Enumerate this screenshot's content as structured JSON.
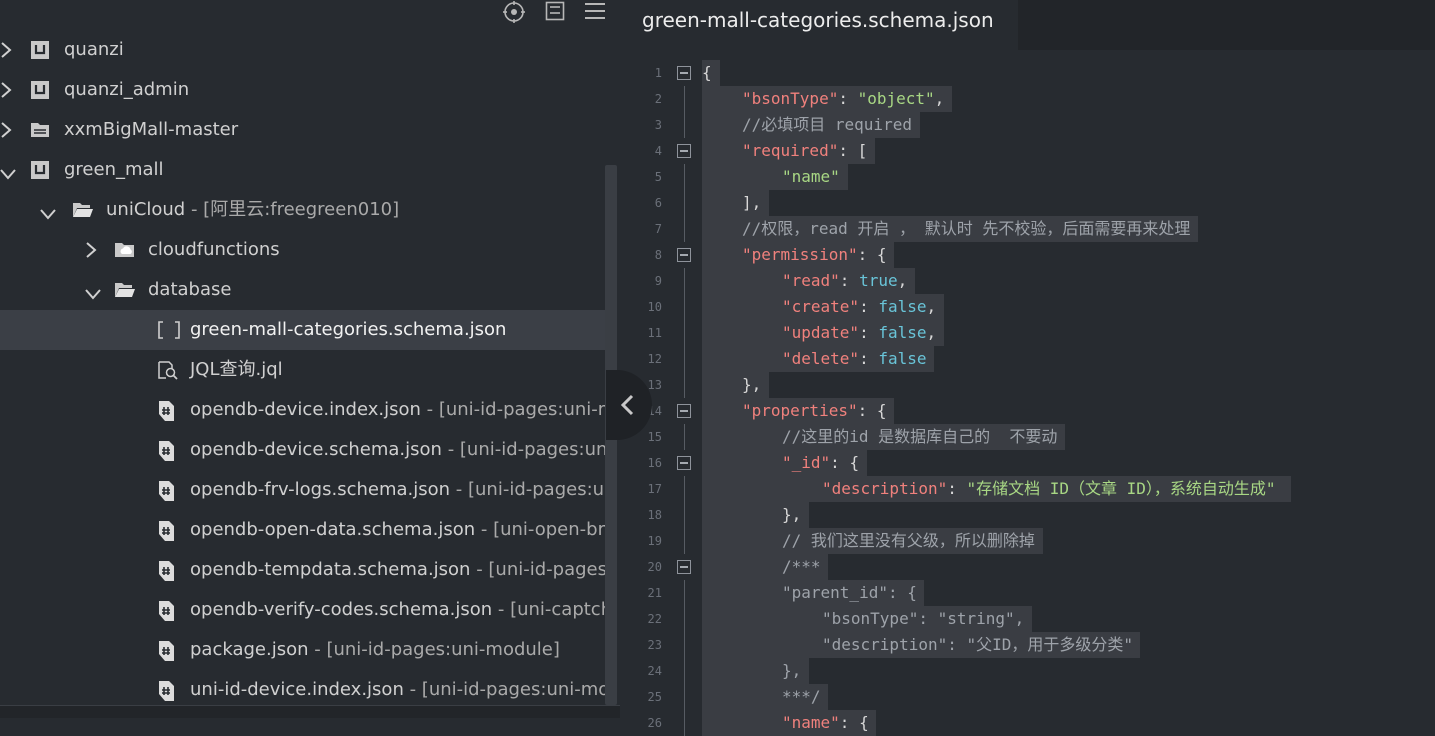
{
  "sidebar": {
    "toolbar": [
      {
        "name": "locate-icon"
      },
      {
        "name": "collapse-all-icon"
      },
      {
        "name": "menu-icon"
      }
    ],
    "tree": [
      {
        "label": "quanzi",
        "desc": "",
        "depth": 0,
        "chevron": "right",
        "icon": "project-icon"
      },
      {
        "label": "quanzi_admin",
        "desc": "",
        "depth": 0,
        "chevron": "right",
        "icon": "project-icon"
      },
      {
        "label": "xxmBigMall-master",
        "desc": "",
        "depth": 0,
        "chevron": "right",
        "icon": "folder-stack-icon"
      },
      {
        "label": "green_mall",
        "desc": "",
        "depth": 0,
        "chevron": "down",
        "icon": "project-icon"
      },
      {
        "label": "uniCloud",
        "desc": " - [阿里云:freegreen010]",
        "depth": 1,
        "chevron": "down",
        "icon": "folder-open-icon"
      },
      {
        "label": "cloudfunctions",
        "desc": "",
        "depth": 2,
        "chevron": "right",
        "icon": "cloud-folder-icon"
      },
      {
        "label": "database",
        "desc": "",
        "depth": 2,
        "chevron": "down",
        "icon": "folder-open-icon"
      },
      {
        "label": "green-mall-categories.schema.json",
        "desc": "",
        "depth": 3,
        "chevron": "",
        "icon": "json-bracket-icon",
        "selected": true
      },
      {
        "label": "JQL查询.jql",
        "desc": "",
        "depth": 3,
        "chevron": "",
        "icon": "jql-search-icon"
      },
      {
        "label": "opendb-device.index.json",
        "desc": " - [uni-id-pages:uni-mo",
        "depth": 3,
        "chevron": "",
        "icon": "json-file-icon"
      },
      {
        "label": "opendb-device.schema.json",
        "desc": " - [uni-id-pages:uni-",
        "depth": 3,
        "chevron": "",
        "icon": "json-file-icon"
      },
      {
        "label": "opendb-frv-logs.schema.json",
        "desc": " - [uni-id-pages:un",
        "depth": 3,
        "chevron": "",
        "icon": "json-file-icon"
      },
      {
        "label": "opendb-open-data.schema.json",
        "desc": " - [uni-open-bric",
        "depth": 3,
        "chevron": "",
        "icon": "json-file-icon"
      },
      {
        "label": "opendb-tempdata.schema.json",
        "desc": " - [uni-id-pages:u",
        "depth": 3,
        "chevron": "",
        "icon": "json-file-icon"
      },
      {
        "label": "opendb-verify-codes.schema.json",
        "desc": " - [uni-captcha",
        "depth": 3,
        "chevron": "",
        "icon": "json-file-icon"
      },
      {
        "label": "package.json",
        "desc": " - [uni-id-pages:uni-module]",
        "depth": 3,
        "chevron": "",
        "icon": "json-file-icon"
      },
      {
        "label": "uni-id-device.index.json",
        "desc": " - [uni-id-pages:uni-moc",
        "depth": 3,
        "chevron": "",
        "icon": "json-file-icon"
      }
    ]
  },
  "editor": {
    "tab_title": "green-mall-categories.schema.json",
    "lines": [
      {
        "n": "1",
        "indent": 0,
        "fold": "open",
        "tokens": [
          [
            "p",
            "{"
          ]
        ]
      },
      {
        "n": "2",
        "indent": 1,
        "tokens": [
          [
            "k",
            "\"bsonType\""
          ],
          [
            "p",
            ": "
          ],
          [
            "s",
            "\"object\""
          ],
          [
            "p",
            ","
          ]
        ]
      },
      {
        "n": "3",
        "indent": 1,
        "tokens": [
          [
            "c",
            "//必填项目 required"
          ]
        ]
      },
      {
        "n": "4",
        "indent": 1,
        "fold": "open",
        "tokens": [
          [
            "k",
            "\"required\""
          ],
          [
            "p",
            ": ["
          ]
        ]
      },
      {
        "n": "5",
        "indent": 2,
        "tokens": [
          [
            "s",
            "\"name\""
          ]
        ]
      },
      {
        "n": "6",
        "indent": 1,
        "tokens": [
          [
            "p",
            "],"
          ]
        ]
      },
      {
        "n": "7",
        "indent": 1,
        "tokens": [
          [
            "c",
            "//权限，read 开启 ， 默认时 先不校验，后面需要再来处理"
          ]
        ]
      },
      {
        "n": "8",
        "indent": 1,
        "fold": "open",
        "tokens": [
          [
            "k",
            "\"permission\""
          ],
          [
            "p",
            ": {"
          ]
        ]
      },
      {
        "n": "9",
        "indent": 2,
        "tokens": [
          [
            "k",
            "\"read\""
          ],
          [
            "p",
            ": "
          ],
          [
            "b",
            "true"
          ],
          [
            "p",
            ","
          ]
        ]
      },
      {
        "n": "10",
        "indent": 2,
        "tokens": [
          [
            "k",
            "\"create\""
          ],
          [
            "p",
            ": "
          ],
          [
            "b",
            "false"
          ],
          [
            "p",
            ","
          ]
        ]
      },
      {
        "n": "11",
        "indent": 2,
        "tokens": [
          [
            "k",
            "\"update\""
          ],
          [
            "p",
            ": "
          ],
          [
            "b",
            "false"
          ],
          [
            "p",
            ","
          ]
        ]
      },
      {
        "n": "12",
        "indent": 2,
        "tokens": [
          [
            "k",
            "\"delete\""
          ],
          [
            "p",
            ": "
          ],
          [
            "b",
            "false"
          ]
        ]
      },
      {
        "n": "13",
        "indent": 1,
        "tokens": [
          [
            "p",
            "},"
          ]
        ]
      },
      {
        "n": "14",
        "indent": 1,
        "fold": "open",
        "tokens": [
          [
            "k",
            "\"properties\""
          ],
          [
            "p",
            ": {"
          ]
        ]
      },
      {
        "n": "15",
        "indent": 2,
        "tokens": [
          [
            "c",
            "//这里的id 是数据库自己的  不要动"
          ]
        ]
      },
      {
        "n": "16",
        "indent": 2,
        "fold": "open",
        "tokens": [
          [
            "k",
            "\"_id\""
          ],
          [
            "p",
            ": {"
          ]
        ]
      },
      {
        "n": "17",
        "indent": 3,
        "tokens": [
          [
            "k",
            "\"description\""
          ],
          [
            "p",
            ": "
          ],
          [
            "s",
            "\"存储文档 ID（文章 ID），系统自动生成\""
          ]
        ]
      },
      {
        "n": "18",
        "indent": 2,
        "tokens": [
          [
            "p",
            "},"
          ]
        ]
      },
      {
        "n": "19",
        "indent": 2,
        "tokens": [
          [
            "c",
            "// 我们这里没有父级，所以删除掉"
          ]
        ]
      },
      {
        "n": "20",
        "indent": 2,
        "fold": "open",
        "tokens": [
          [
            "c",
            "/***"
          ]
        ]
      },
      {
        "n": "21",
        "indent": 2,
        "tokens": [
          [
            "c",
            "\"parent_id\": {"
          ]
        ]
      },
      {
        "n": "22",
        "indent": 3,
        "tokens": [
          [
            "c",
            "\"bsonType\": \"string\","
          ]
        ]
      },
      {
        "n": "23",
        "indent": 3,
        "tokens": [
          [
            "c",
            "\"description\": \"父ID，用于多级分类\""
          ]
        ]
      },
      {
        "n": "24",
        "indent": 2,
        "tokens": [
          [
            "c",
            "},"
          ]
        ]
      },
      {
        "n": "25",
        "indent": 2,
        "tokens": [
          [
            "c",
            "***/"
          ]
        ]
      },
      {
        "n": "26",
        "indent": 2,
        "tokens": [
          [
            "k",
            "\"name\""
          ],
          [
            "p",
            ": {"
          ]
        ]
      }
    ]
  }
}
